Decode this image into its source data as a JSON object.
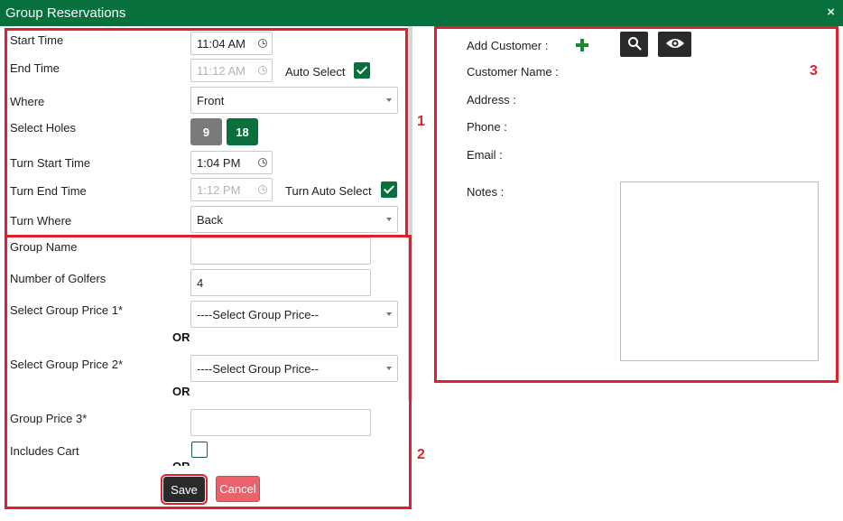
{
  "window": {
    "title": "Group Reservations",
    "close_icon": "×"
  },
  "left_top": {
    "start_time_label": "Start Time",
    "start_time_value": "11:04 AM",
    "end_time_label": "End Time",
    "end_time_value": "11:12 AM",
    "auto_select_label": "Auto Select",
    "where_label": "Where",
    "where_value": "Front",
    "select_holes_label": "Select Holes",
    "hole_options": [
      "9",
      "18"
    ],
    "hole_selected": "18",
    "turn_start_time_label": "Turn Start Time",
    "turn_start_time_value": "1:04 PM",
    "turn_end_time_label": "Turn End Time",
    "turn_end_time_value": "1:12 PM",
    "turn_auto_select_label": "Turn Auto Select",
    "turn_where_label": "Turn Where",
    "turn_where_value": "Back"
  },
  "left_bottom": {
    "group_name_label": "Group Name",
    "group_name_value": "",
    "number_of_golfers_label": "Number of Golfers",
    "number_of_golfers_value": "4",
    "group_price_1_label": "Select Group Price 1*",
    "group_price_1_value": "----Select Group Price--",
    "or_text": "OR",
    "group_price_2_label": "Select Group Price 2*",
    "group_price_2_value": "----Select Group Price--",
    "group_price_3_label": "Group Price 3*",
    "group_price_3_value": "",
    "includes_cart_label": "Includes Cart",
    "includes_cart_checked": false
  },
  "buttons": {
    "save": "Save",
    "cancel": "Cancel"
  },
  "right": {
    "add_customer_label": "Add Customer :",
    "customer_name_label": "Customer Name :",
    "address_label": "Address :",
    "phone_label": "Phone :",
    "email_label": "Email :",
    "notes_label": "Notes :",
    "icons": [
      "plus-icon",
      "search-icon",
      "eye-icon"
    ]
  },
  "annotations": {
    "box_1": "1",
    "box_2": "2",
    "box_3": "3"
  },
  "colors": {
    "brand_green": "#07703d",
    "hole_inactive": "#7a7a7a",
    "highlight_red": "#e0212d",
    "cancel_red": "#e8636b",
    "dark_button": "#2a2a2a"
  }
}
